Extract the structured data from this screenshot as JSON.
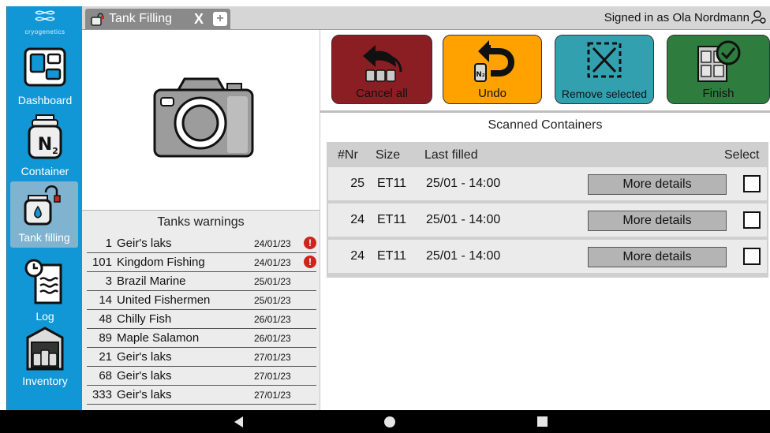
{
  "app": {
    "brand": "cryogenetics"
  },
  "sidebar": {
    "items": [
      {
        "label": "Dashboard",
        "icon": "dashboard-icon"
      },
      {
        "label": "Container",
        "icon": "n2-container-icon"
      },
      {
        "label": "Tank filling",
        "icon": "tank-filling-icon",
        "active": true
      },
      {
        "label": "Log",
        "icon": "log-icon"
      },
      {
        "label": "Inventory",
        "icon": "inventory-icon"
      }
    ]
  },
  "tabbar": {
    "tab_title": "Tank Filling",
    "close_label": "X",
    "add_label": "+",
    "signed_in": "Signed in as Ola Nordmann"
  },
  "actions": {
    "cancel_all": "Cancel all",
    "undo": "Undo",
    "remove_selected": "Remove selected",
    "finish": "Finish",
    "colors": {
      "cancel": "#8b1e23",
      "undo": "#ffa200",
      "remove": "#33a0b0",
      "finish": "#2e7d3e"
    }
  },
  "warnings": {
    "title": "Tanks warnings",
    "rows": [
      {
        "nr": "1",
        "name": "Geir's laks",
        "date": "24/01/23",
        "alert": true
      },
      {
        "nr": "101",
        "name": "Kingdom Fishing",
        "date": "24/01/23",
        "alert": true
      },
      {
        "nr": "3",
        "name": "Brazil Marine",
        "date": "25/01/23",
        "alert": false
      },
      {
        "nr": "14",
        "name": "United Fishermen",
        "date": "25/01/23",
        "alert": false
      },
      {
        "nr": "48",
        "name": "Chilly Fish",
        "date": "26/01/23",
        "alert": false
      },
      {
        "nr": "89",
        "name": "Maple Salamon",
        "date": "26/01/23",
        "alert": false
      },
      {
        "nr": "21",
        "name": "Geir's laks",
        "date": "27/01/23",
        "alert": false
      },
      {
        "nr": "68",
        "name": "Geir's laks",
        "date": "27/01/23",
        "alert": false
      },
      {
        "nr": "333",
        "name": "Geir's laks",
        "date": "27/01/23",
        "alert": false
      }
    ]
  },
  "scanned": {
    "title": "Scanned Containers",
    "headers": {
      "nr": "#Nr",
      "size": "Size",
      "last": "Last filled",
      "select": "Select"
    },
    "rows": [
      {
        "nr": "25",
        "size": "ET11",
        "last": "25/01 - 14:00",
        "button": "More details"
      },
      {
        "nr": "24",
        "size": "ET11",
        "last": "25/01 - 14:00",
        "button": "More details"
      },
      {
        "nr": "24",
        "size": "ET11",
        "last": "25/01 - 14:00",
        "button": "More details"
      }
    ]
  }
}
